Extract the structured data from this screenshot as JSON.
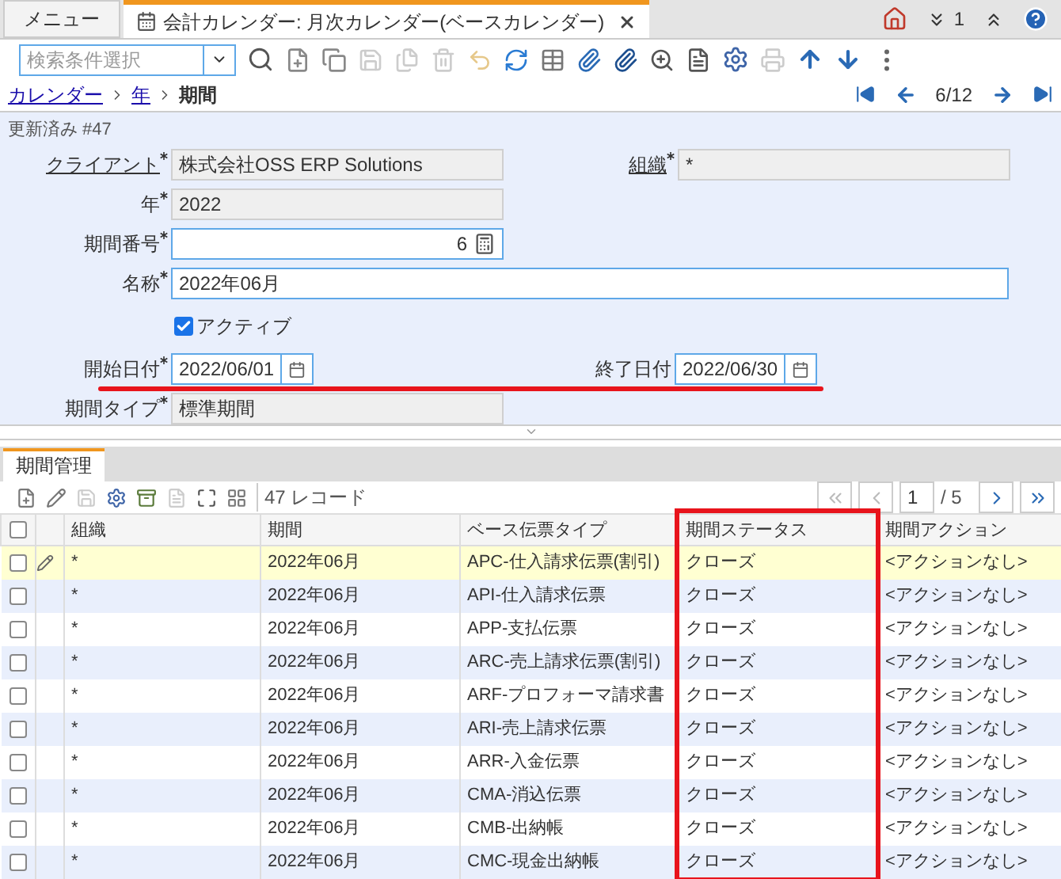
{
  "window_tabs": [
    {
      "label": "メニュー",
      "selected": false,
      "closable": false
    },
    {
      "label": "会計カレンダー: 月次カレンダー(ベースカレンダー)",
      "selected": true,
      "closable": true
    }
  ],
  "header_badge": "1",
  "search": {
    "placeholder": "検索条件選択"
  },
  "breadcrumb": [
    {
      "label": "カレンダー",
      "link": true
    },
    {
      "label": "年",
      "link": true
    },
    {
      "label": "期間",
      "link": false
    }
  ],
  "record_nav": "6/12",
  "status": "更新済み #47",
  "form": {
    "rows": [
      {
        "fields": [
          {
            "kind": "text",
            "label": "クライアント",
            "link": true,
            "required": true,
            "value": "株式会社OSS ERP Solutions",
            "readonly": true
          },
          {
            "kind": "text",
            "label": "組織",
            "link": true,
            "required": true,
            "value": "*",
            "readonly": true
          }
        ]
      },
      {
        "fields": [
          {
            "kind": "text",
            "label": "年",
            "link": false,
            "required": true,
            "value": "2022",
            "readonly": true
          }
        ]
      },
      {
        "fields": [
          {
            "kind": "number",
            "label": "期間番号",
            "link": false,
            "required": true,
            "value": "6",
            "readonly": false
          }
        ]
      },
      {
        "fields": [
          {
            "kind": "wide",
            "label": "名称",
            "link": false,
            "required": true,
            "value": "2022年06月",
            "readonly": false
          }
        ]
      },
      {
        "fields": [
          {
            "kind": "checkbox",
            "label": "アクティブ",
            "checked": true
          }
        ]
      },
      {
        "fields": [
          {
            "kind": "date",
            "label": "開始日付",
            "link": false,
            "required": true,
            "value": "2022/06/01",
            "readonly": false
          },
          {
            "kind": "date",
            "label": "終了日付",
            "link": false,
            "required": false,
            "value": "2022/06/30",
            "readonly": false
          }
        ],
        "underlined": true
      },
      {
        "fields": [
          {
            "kind": "text",
            "label": "期間タイプ",
            "link": false,
            "required": true,
            "value": "標準期間",
            "readonly": true
          }
        ]
      }
    ]
  },
  "detail_tab": {
    "label": "期間管理",
    "selected": true
  },
  "grid": {
    "record_count": "47 レコード",
    "page": "1",
    "page_total": "/ 5",
    "select_all_checked": false,
    "columns": [
      {
        "label": "組織",
        "framed": false
      },
      {
        "label": "期間",
        "framed": false
      },
      {
        "label": "ベース伝票タイプ",
        "framed": false
      },
      {
        "label": "期間ステータス",
        "framed": true
      },
      {
        "label": "期間アクション",
        "framed": false
      }
    ],
    "rows": [
      {
        "selected": true,
        "checked": false,
        "cells": [
          "*",
          "2022年06月",
          "APC-仕入請求伝票(割引)",
          "クローズ",
          "<アクションなし>"
        ]
      },
      {
        "selected": false,
        "checked": false,
        "cells": [
          "*",
          "2022年06月",
          "API-仕入請求伝票",
          "クローズ",
          "<アクションなし>"
        ]
      },
      {
        "selected": false,
        "checked": false,
        "cells": [
          "*",
          "2022年06月",
          "APP-支払伝票",
          "クローズ",
          "<アクションなし>"
        ]
      },
      {
        "selected": false,
        "checked": false,
        "cells": [
          "*",
          "2022年06月",
          "ARC-売上請求伝票(割引)",
          "クローズ",
          "<アクションなし>"
        ]
      },
      {
        "selected": false,
        "checked": false,
        "cells": [
          "*",
          "2022年06月",
          "ARF-プロフォーマ請求書",
          "クローズ",
          "<アクションなし>"
        ]
      },
      {
        "selected": false,
        "checked": false,
        "cells": [
          "*",
          "2022年06月",
          "ARI-売上請求伝票",
          "クローズ",
          "<アクションなし>"
        ]
      },
      {
        "selected": false,
        "checked": false,
        "cells": [
          "*",
          "2022年06月",
          "ARR-入金伝票",
          "クローズ",
          "<アクションなし>"
        ]
      },
      {
        "selected": false,
        "checked": false,
        "cells": [
          "*",
          "2022年06月",
          "CMA-消込伝票",
          "クローズ",
          "<アクションなし>"
        ]
      },
      {
        "selected": false,
        "checked": false,
        "cells": [
          "*",
          "2022年06月",
          "CMB-出納帳",
          "クローズ",
          "<アクションなし>"
        ]
      },
      {
        "selected": false,
        "checked": false,
        "cells": [
          "*",
          "2022年06月",
          "CMC-現金出納帳",
          "クローズ",
          "<アクションなし>"
        ]
      }
    ]
  }
}
